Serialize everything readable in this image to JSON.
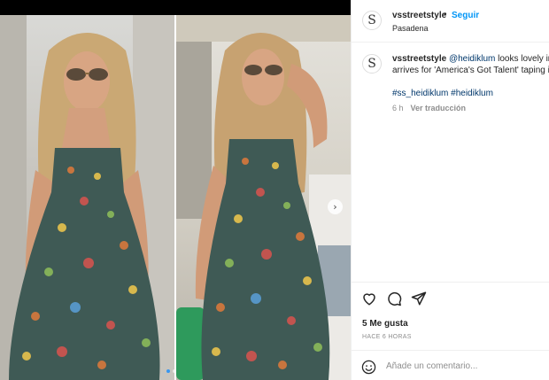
{
  "post": {
    "username": "vsstreetstyle",
    "follow_label": "Seguir",
    "location": "Pasadena",
    "separator": "•",
    "avatar_letter": "S"
  },
  "caption": {
    "username": "vsstreetstyle",
    "mention": "@heidiklum",
    "line1_rest": " looks lovely in",
    "line2": "arrives for 'America's Got Talent' taping i",
    "hashtags": "#ss_heidiklum #heidiklum",
    "time": "6 h",
    "translate_label": "Ver traducción"
  },
  "actions": {
    "likes": "5 Me gusta",
    "ago": "HACE 6 HORAS",
    "icons": [
      "heart-icon",
      "comment-icon",
      "share-icon"
    ]
  },
  "comment_box": {
    "placeholder": "Añade un comentario..."
  },
  "media": {
    "carousel_position": 1,
    "carousel_total": 2,
    "next_glyph": "›"
  },
  "colors": {
    "accent": "#0095f6",
    "link": "#00376b",
    "muted": "#8e8e8e",
    "text": "#262626"
  }
}
